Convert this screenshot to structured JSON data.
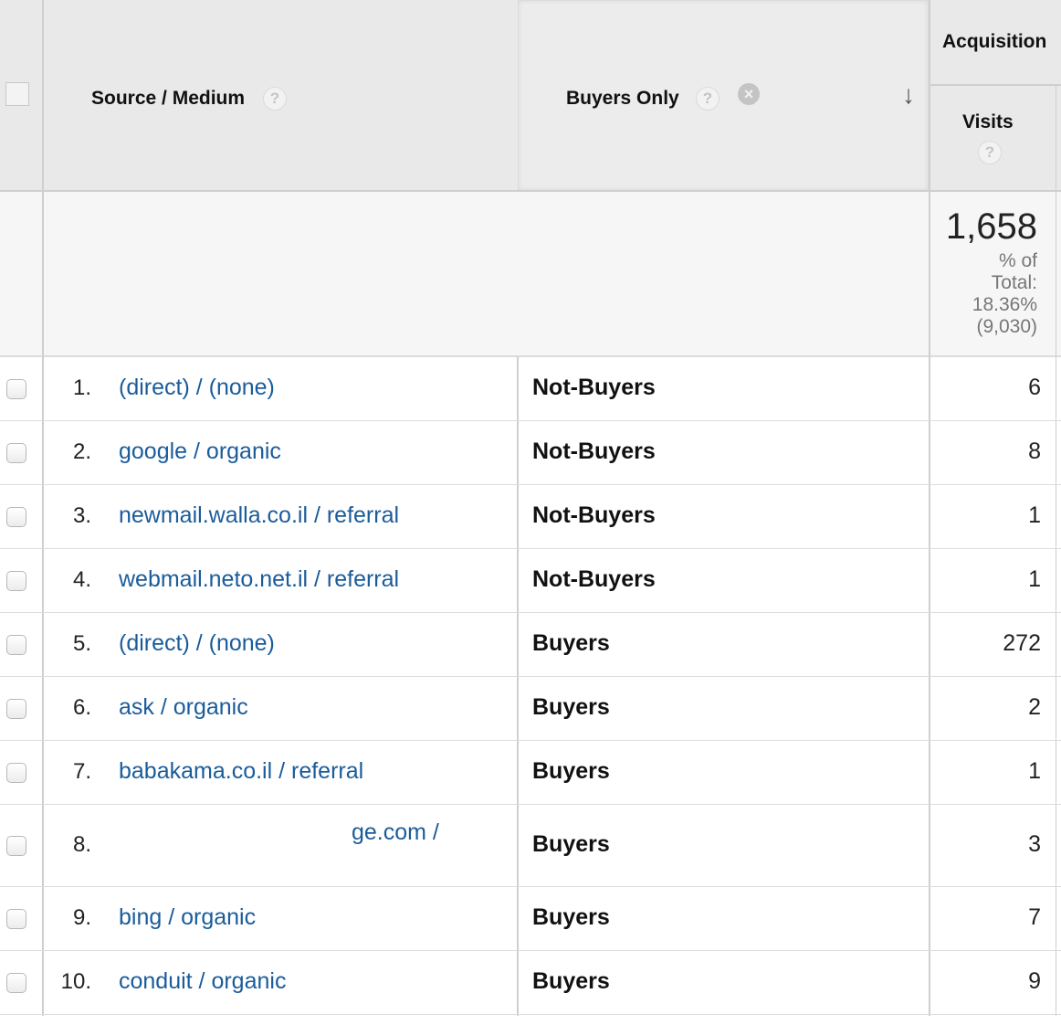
{
  "header": {
    "col_source": "Source / Medium",
    "col_buyers": "Buyers Only",
    "group_acquisition": "Acquisition",
    "col_visits": "Visits",
    "help_glyph": "?",
    "close_glyph": "×",
    "sort_glyph": "↓"
  },
  "summary": {
    "total": "1,658",
    "pct_line1": "% of",
    "pct_line2": "Total:",
    "pct_line3": "18.36%",
    "pct_line4": "(9,030)"
  },
  "rows": [
    {
      "num": "1.",
      "source": "(direct) / (none)",
      "segment": "Not-Buyers",
      "visits": "6"
    },
    {
      "num": "2.",
      "source": "google / organic",
      "segment": "Not-Buyers",
      "visits": "8"
    },
    {
      "num": "3.",
      "source": "newmail.walla.co.il / referral",
      "segment": "Not-Buyers",
      "visits": "1"
    },
    {
      "num": "4.",
      "source": "webmail.neto.net.il / referral",
      "segment": "Not-Buyers",
      "visits": "1"
    },
    {
      "num": "5.",
      "source": "(direct) / (none)",
      "segment": "Buyers",
      "visits": "272"
    },
    {
      "num": "6.",
      "source": "ask / organic",
      "segment": "Buyers",
      "visits": "2"
    },
    {
      "num": "7.",
      "source": "babakama.co.il / referral",
      "segment": "Buyers",
      "visits": "1"
    },
    {
      "num": "8.",
      "source": "ge.com /",
      "segment": "Buyers",
      "visits": "3"
    },
    {
      "num": "9.",
      "source": "bing / organic",
      "segment": "Buyers",
      "visits": "7"
    },
    {
      "num": "10.",
      "source": "conduit / organic",
      "segment": "Buyers",
      "visits": "9"
    }
  ]
}
